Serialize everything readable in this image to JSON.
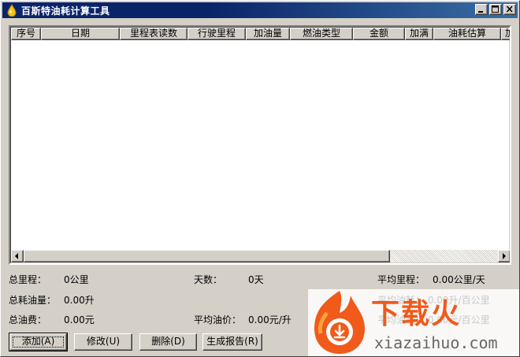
{
  "window": {
    "title": "百斯特油耗计算工具",
    "title_icon": "fuel-drop-icon",
    "buttons": [
      "minimize-icon",
      "maximize-icon",
      "close-icon"
    ]
  },
  "table": {
    "columns": [
      "序号",
      "日期",
      "里程表读数",
      "行驶里程",
      "加油量",
      "燃油类型",
      "金额",
      "加满",
      "油耗估算",
      "加"
    ],
    "rows": []
  },
  "stats": {
    "total_distance_label": "总里程：",
    "total_distance_value": "0公里",
    "days_label": "天数：",
    "days_value": "0天",
    "avg_distance_label": "平均里程：",
    "avg_distance_value": "0.00公里/天",
    "total_fuel_label": "总耗油量：",
    "total_fuel_value": "0.00升",
    "total_cost_label": "总油费：",
    "total_cost_value": "0.00元",
    "avg_price_label": "平均油价：",
    "avg_price_value": "0.00元/升",
    "avg_consumption_ghost": "平均油耗：  0.00升/百公里",
    "avg_cost_ghost": "平均油费：  0.00元/百公里"
  },
  "actions": {
    "add_label": "添加(A)",
    "edit_label": "修改(U)",
    "delete_label": "删除(D)",
    "report_label": "生成报告(R)"
  },
  "watermark": {
    "brand": "下载火",
    "url": "xiazaihuo.com",
    "colors": {
      "flame": "#f05a1a",
      "flame_light": "#f9a23b"
    }
  },
  "colors": {
    "titlebar": "#0a246a",
    "face": "#d4d0c8"
  }
}
